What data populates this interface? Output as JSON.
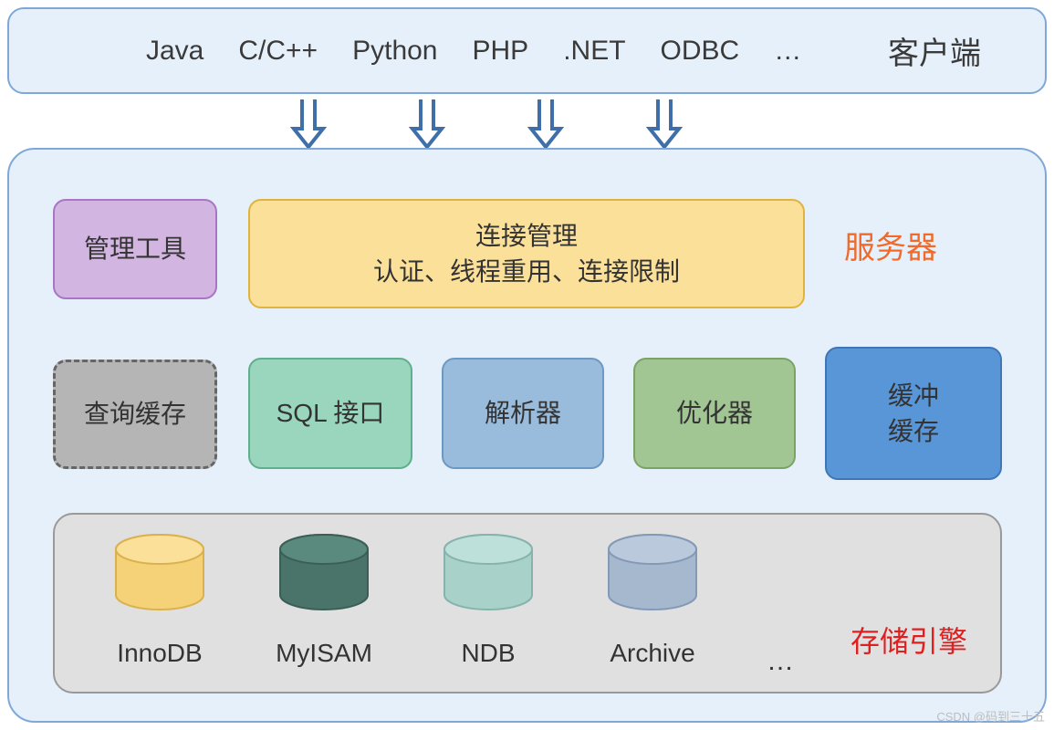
{
  "client": {
    "items": [
      "Java",
      "C/C++",
      "Python",
      "PHP",
      ".NET",
      "ODBC",
      "…"
    ],
    "label": "客户端"
  },
  "server": {
    "label": "服务器",
    "mgmt_tool": "管理工具",
    "conn_mgmt": {
      "line1": "连接管理",
      "line2": "认证、线程重用、连接限制"
    },
    "query_cache": "查询缓存",
    "sql_iface": "SQL 接口",
    "parser": "解析器",
    "optimizer": "优化器",
    "buffer_cache": {
      "line1": "缓冲",
      "line2": "缓存"
    },
    "storage": {
      "label": "存储引擎",
      "engines": [
        "InnoDB",
        "MyISAM",
        "NDB",
        "Archive"
      ],
      "ellipsis": "…"
    }
  },
  "watermark": "CSDN @码到三十五",
  "colors": {
    "cylinders": [
      {
        "top": "#fbe09a",
        "side": "#f5d278",
        "stroke": "#d9b24f"
      },
      {
        "top": "#5a8a7d",
        "side": "#4a7369",
        "stroke": "#3c5e56"
      },
      {
        "top": "#bde0db",
        "side": "#a8d1ca",
        "stroke": "#86b3ab"
      },
      {
        "top": "#bac9dc",
        "side": "#a6b8ce",
        "stroke": "#8399b5"
      }
    ]
  }
}
